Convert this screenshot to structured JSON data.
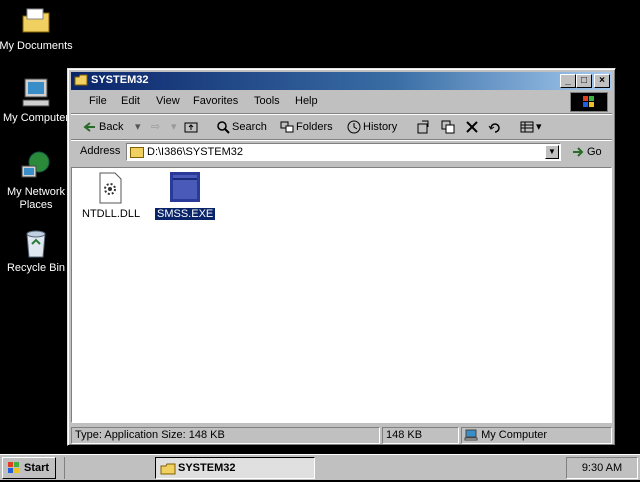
{
  "desktop": {
    "icons": [
      {
        "label": "My Documents"
      },
      {
        "label": "My Computer"
      },
      {
        "label": "My Network Places"
      },
      {
        "label": "Recycle Bin"
      }
    ]
  },
  "window": {
    "title": "SYSTEM32",
    "menu": [
      "File",
      "Edit",
      "View",
      "Favorites",
      "Tools",
      "Help"
    ],
    "toolbar": {
      "back": "Back",
      "search": "Search",
      "folders": "Folders",
      "history": "History"
    },
    "address": {
      "label": "Address",
      "value": "D:\\I386\\SYSTEM32",
      "go": "Go"
    },
    "files": [
      {
        "name": "NTDLL.DLL",
        "selected": false
      },
      {
        "name": "SMSS.EXE",
        "selected": true
      }
    ],
    "status": {
      "info": "Type: Application Size: 148 KB",
      "size": "148 KB",
      "zone": "My Computer"
    }
  },
  "taskbar": {
    "start": "Start",
    "task": "SYSTEM32",
    "clock": "9:30 AM"
  }
}
